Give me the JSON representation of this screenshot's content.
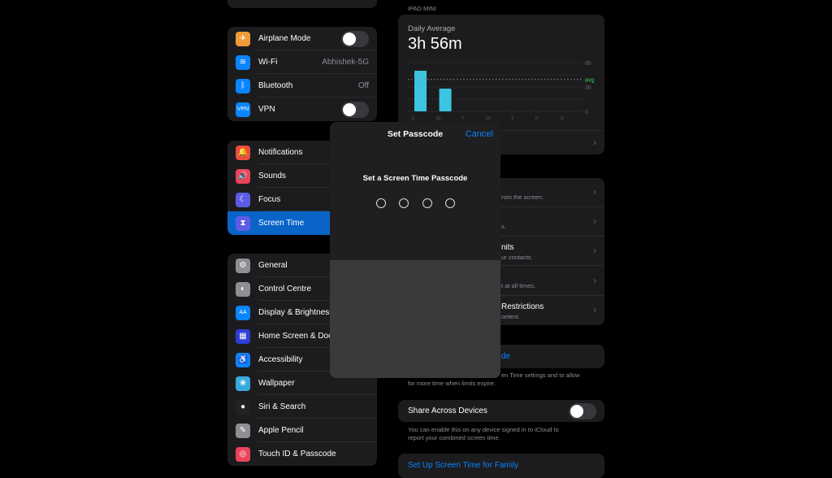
{
  "sidebar": {
    "group1": [
      {
        "label": "Airplane Mode",
        "icon": "airplane-icon",
        "color": "#f09a37",
        "toggle": false
      },
      {
        "label": "Wi-Fi",
        "icon": "wifi-icon",
        "color": "#0a84ff",
        "value": "Abhishek-5G"
      },
      {
        "label": "Bluetooth",
        "icon": "bluetooth-icon",
        "color": "#0a84ff",
        "value": "Off"
      },
      {
        "label": "VPN",
        "icon": "vpn-icon",
        "color": "#0a84ff",
        "icon_text": "VPN",
        "toggle": false
      }
    ],
    "group2": [
      {
        "label": "Notifications",
        "icon": "bell-icon",
        "color": "#eb4d3d"
      },
      {
        "label": "Sounds",
        "icon": "speaker-icon",
        "color": "#eb445a"
      },
      {
        "label": "Focus",
        "icon": "moon-icon",
        "color": "#5e5ce6"
      },
      {
        "label": "Screen Time",
        "icon": "hourglass-icon",
        "color": "#5e5ce6",
        "selected": true
      }
    ],
    "group3": [
      {
        "label": "General",
        "icon": "gear-icon",
        "color": "#8e8e93"
      },
      {
        "label": "Control Centre",
        "icon": "switches-icon",
        "color": "#8e8e93"
      },
      {
        "label": "Display & Brightness",
        "icon": "text-size-icon",
        "color": "#0a84ff",
        "icon_text": "AA"
      },
      {
        "label": "Home Screen & Dock",
        "icon": "home-grid-icon",
        "color": "#2c3ed6"
      },
      {
        "label": "Accessibility",
        "icon": "accessibility-icon",
        "color": "#0a84ff"
      },
      {
        "label": "Wallpaper",
        "icon": "flower-icon",
        "color": "#36aadc"
      },
      {
        "label": "Siri & Search",
        "icon": "siri-icon",
        "color": "#222"
      },
      {
        "label": "Apple Pencil",
        "icon": "pencil-icon",
        "color": "#8e8e93"
      },
      {
        "label": "Touch ID & Passcode",
        "icon": "fingerprint-icon",
        "color": "#eb445a"
      }
    ]
  },
  "main": {
    "device_label": "IPAD MINI",
    "daily_average_label": "Daily Average",
    "daily_average_value": "3h 56m",
    "rows": [
      {
        "subtitle": "rom the screen."
      },
      {
        "subtitle": "s."
      },
      {
        "title": "nits",
        "subtitle": "ur contacts."
      },
      {
        "subtitle": "t at all times."
      },
      {
        "title": "Restrictions",
        "subtitle": "ontent."
      }
    ],
    "passcode_link": "de",
    "passcode_footer_1": "en Time settings and to allow",
    "passcode_footer_2": "for more time when limits expire.",
    "share_label": "Share Across Devices",
    "share_on": false,
    "share_footer_1": "You can enable this on any device signed in to iCloud to",
    "share_footer_2": "report your combined screen time.",
    "family_link": "Set Up Screen Time for Family"
  },
  "chart_data": {
    "type": "bar",
    "categories": [
      "S",
      "M",
      "T",
      "W",
      "T",
      "F",
      "S"
    ],
    "values": [
      5.0,
      2.8,
      0,
      0,
      0,
      0,
      0
    ],
    "y_ticks": [
      "6h",
      "3h",
      "0"
    ],
    "ylim": [
      0,
      6
    ],
    "average": 3.93,
    "average_label": "avg",
    "bar_color": "#3bc5e0",
    "avg_color": "#30d158",
    "grid": true
  },
  "dialog": {
    "title": "Set Passcode",
    "cancel": "Cancel",
    "prompt": "Set a Screen Time Passcode",
    "digits": 4,
    "accent": "#0a84ff"
  }
}
